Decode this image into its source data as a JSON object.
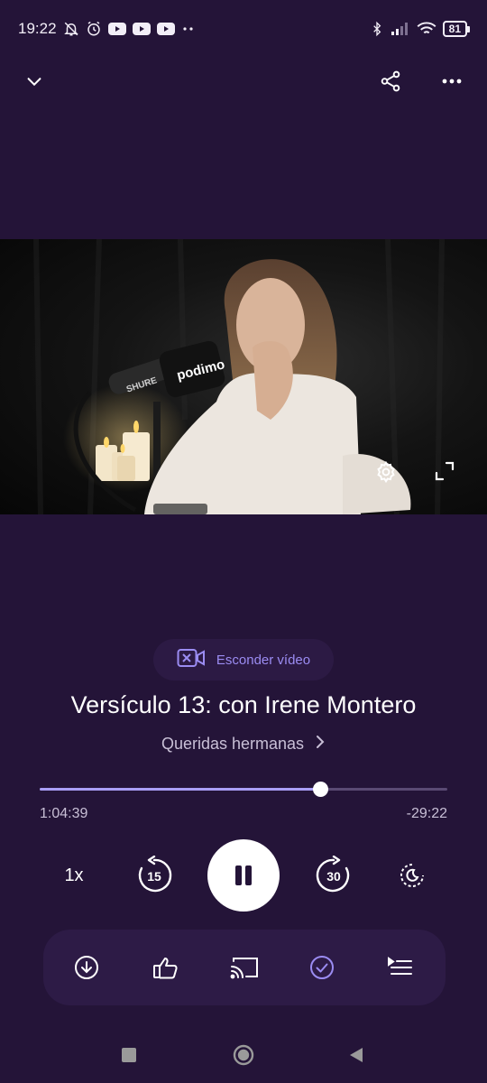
{
  "status_bar": {
    "time": "19:22",
    "battery": "81",
    "left_icons": [
      "bell-off-icon",
      "alarm-icon",
      "youtube-icon",
      "youtube-icon",
      "youtube-icon",
      "more-dots-icon"
    ],
    "right_icons": [
      "bluetooth-icon",
      "signal-icon",
      "wifi-icon",
      "battery-icon"
    ]
  },
  "top_nav": {
    "icons": [
      "chevron-down-icon",
      "share-icon",
      "more-horizontal-icon"
    ]
  },
  "video": {
    "mic_brand": "SHURE",
    "mic_logo": "podimo",
    "icons": [
      "settings-icon",
      "fullscreen-icon"
    ]
  },
  "hide_video": {
    "label": "Esconder vídeo",
    "icon": "video-off-icon"
  },
  "episode": {
    "title": "Versículo 13: con Irene Montero",
    "show": "Queridas hermanas"
  },
  "playback": {
    "elapsed": "1:04:39",
    "remaining": "-29:22",
    "progress_fraction": 0.688,
    "speed": "1x",
    "rewind_seconds": "15",
    "forward_seconds": "30",
    "state": "playing"
  },
  "actions": {
    "icons": [
      "download-icon",
      "thumbs-up-icon",
      "cast-icon",
      "check-circle-icon",
      "queue-icon"
    ]
  },
  "colors": {
    "background": "#241438",
    "accent": "#9b8cf2",
    "progress_fill": "#a99ef5",
    "card": "#2d1b46"
  }
}
